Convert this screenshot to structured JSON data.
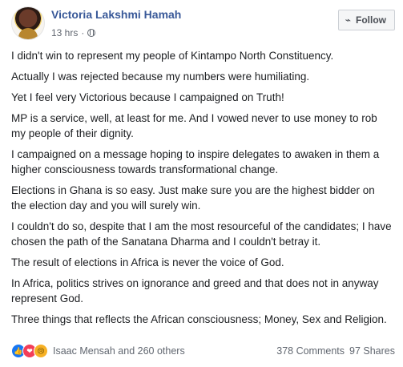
{
  "post": {
    "author": "Victoria Lakshmi Hamah",
    "time": "13 hrs",
    "follow_label": "Follow",
    "paragraphs": [
      "I didn't win to represent my people of Kintampo North Constituency.",
      "Actually I was rejected because my numbers were humiliating.",
      "Yet I feel very Victorious because I campaigned on Truth!",
      "MP is a service, well, at least for me. And I vowed never to use money to rob my people of their dignity.",
      "I campaigned on a message hoping to inspire delegates to awaken in them a higher consciousness towards transformational change.",
      "Elections in Ghana is so easy. Just make sure you are the highest bidder on the election day and you will surely win.",
      "I couldn't do so, despite that I am the most resourceful of the candidates; I have chosen the path of the Sanatana Dharma and I couldn't betray it.",
      "The result of elections in Africa is never the voice of God.",
      "In Africa, politics strives on ignorance and greed and that does not in anyway represent God.",
      "Three things that reflects the African consciousness; Money, Sex and Religion."
    ],
    "reactions": {
      "icons": [
        "like-icon",
        "love-icon",
        "sad-icon"
      ],
      "glyphs": [
        "👍",
        "❤",
        "😢"
      ],
      "reactors": "Isaac Mensah and 260 others"
    },
    "comments": "378 Comments",
    "shares": "97 Shares"
  },
  "colors": {
    "author": "#385898",
    "meta": "#616770",
    "like": "#1877f2",
    "love": "#f33e58",
    "sad": "#f7b125"
  }
}
